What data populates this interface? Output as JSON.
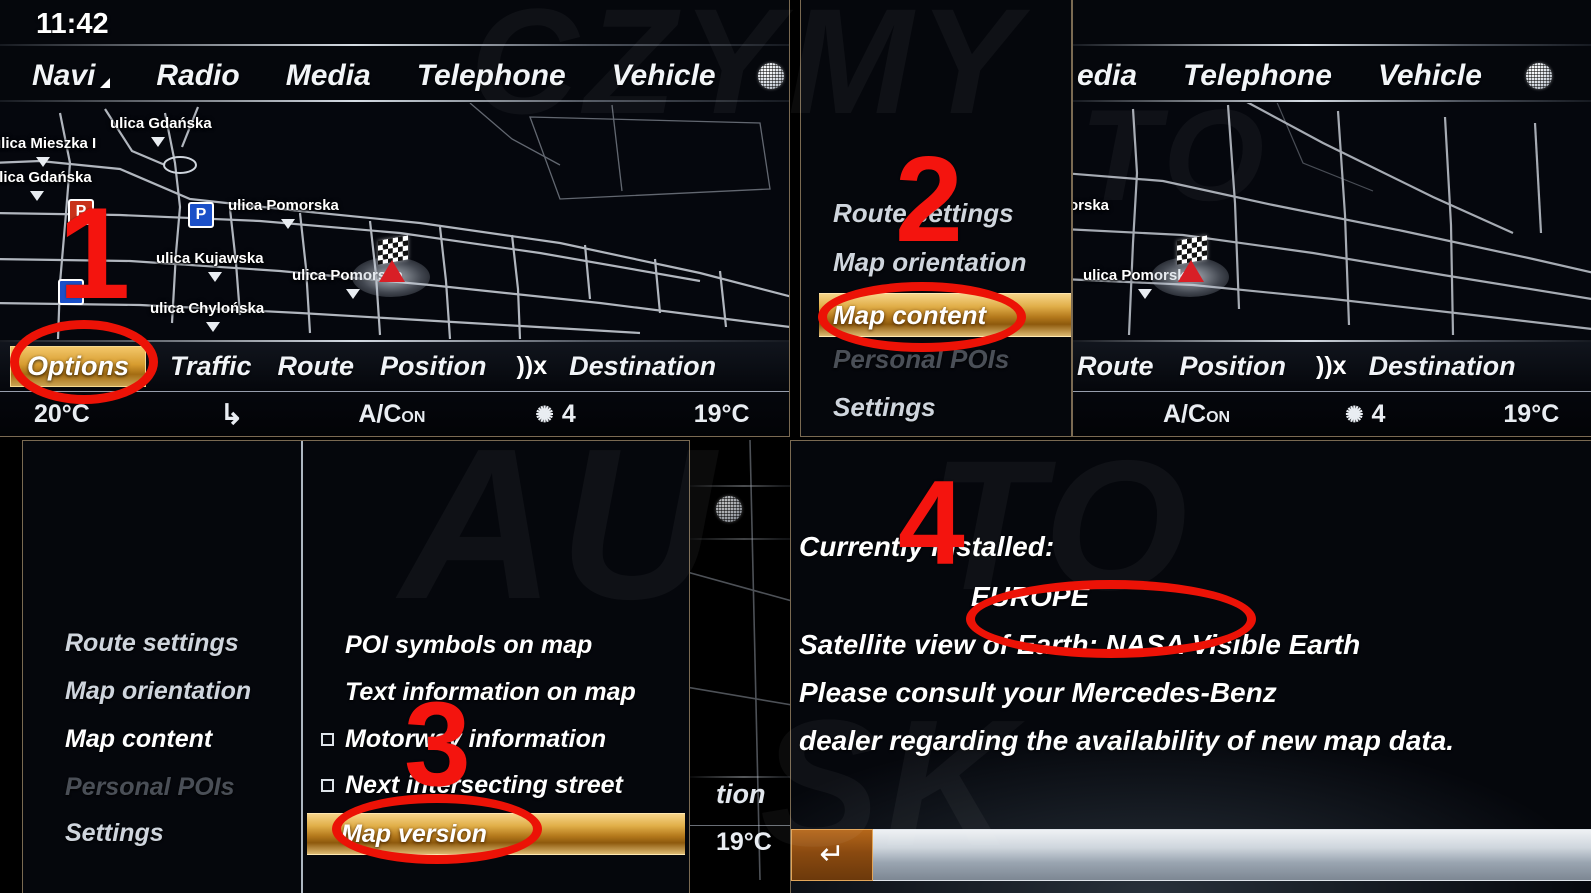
{
  "panels": {
    "p1": {
      "clock": "11:42",
      "main_menu": [
        "Navi",
        "Radio",
        "Media",
        "Telephone",
        "Vehicle"
      ],
      "globe_icon": "globe-icon",
      "map": {
        "streets": [
          "ulica Gdańska",
          "ulica Mieszka I",
          "ulica Gdańska",
          "ulica Pomorska",
          "ulica Kujawska",
          "ulica Pomorska",
          "ulica Chylońska"
        ],
        "parking_icons": [
          "P",
          "P",
          "P"
        ],
        "position_marker": "vehicle-position-marker",
        "destination_marker": "checkered-flag-icon"
      },
      "nav_items": [
        "Options",
        "Traffic",
        "Route",
        "Position",
        "Destination"
      ],
      "nav_selected": "Options",
      "sound_icon": "sound-wave-ear-icon",
      "climate": {
        "left_temp": "20°C",
        "seat_icon": "seat-heating-icon",
        "ac": "A/C",
        "ac_state": "ON",
        "fan_icon": "fan-icon",
        "fan_level": "4",
        "right_temp": "19°C"
      }
    },
    "p2": {
      "options_menu": [
        {
          "label": "Route settings",
          "state": "normal"
        },
        {
          "label": "Map orientation",
          "state": "normal"
        },
        {
          "label": "Map content",
          "state": "highlighted"
        },
        {
          "label": "Personal POIs",
          "state": "disabled"
        },
        {
          "label": "Settings",
          "state": "normal"
        }
      ]
    },
    "p3": {
      "main_menu_partial": [
        "edia",
        "Telephone",
        "Vehicle"
      ],
      "globe_icon": "globe-icon",
      "nav_items_partial": [
        "Route",
        "Position",
        "Destination"
      ],
      "sound_icon": "sound-wave-ear-icon",
      "climate": {
        "ac": "A/C",
        "ac_state": "ON",
        "fan_icon": "fan-icon",
        "fan_level": "4",
        "right_temp": "19°C"
      },
      "map": {
        "streets": [
          "orska",
          "ulica Pomorska"
        ],
        "position_marker": "vehicle-position-marker",
        "destination_marker": "checkered-flag-icon"
      }
    },
    "p4": {
      "options_menu": [
        {
          "label": "Route settings",
          "state": "normal"
        },
        {
          "label": "Map orientation",
          "state": "normal"
        },
        {
          "label": "Map content",
          "state": "active"
        },
        {
          "label": "Personal POIs",
          "state": "disabled"
        },
        {
          "label": "Settings",
          "state": "normal"
        }
      ],
      "submenu": [
        {
          "label": "POI symbols on map",
          "checkbox": false,
          "state": "normal"
        },
        {
          "label": "Text information on map",
          "checkbox": false,
          "state": "normal"
        },
        {
          "label": "Motorway information",
          "checkbox": true,
          "checked": false,
          "state": "normal"
        },
        {
          "label": "Next intersecting street",
          "checkbox": true,
          "checked": false,
          "state": "normal"
        },
        {
          "label": "Map version",
          "checkbox": false,
          "state": "highlighted"
        }
      ],
      "ghost": {
        "nav_partial": "tion",
        "temp": "19°C",
        "globe_icon": "globe-icon"
      }
    },
    "p5": {
      "lines": [
        "Currently installed:",
        "EUROPE",
        "Satellite view of Earth: NASA Visible Earth",
        "Please consult your Mercedes-Benz",
        "dealer regarding the availability of new map data."
      ],
      "installed_label": "Currently installed:",
      "installed_value": "EUROPE",
      "back_icon": "back-arrow-icon"
    }
  },
  "annotations": {
    "step1": "1",
    "step2": "2",
    "step3": "3",
    "step4": "4"
  },
  "watermark": {
    "l1": "CZYMY",
    "l2": "AU",
    "l3": "TO",
    "l4": "SK",
    "l5": "TO"
  },
  "colors": {
    "accent_gold": "#d79c2f",
    "annotation_red": "#ec1206",
    "screen_bg": "#05070c",
    "poi_blue": "#1b50c8",
    "poi_red": "#c8321b",
    "marker_red": "#d81f26"
  }
}
